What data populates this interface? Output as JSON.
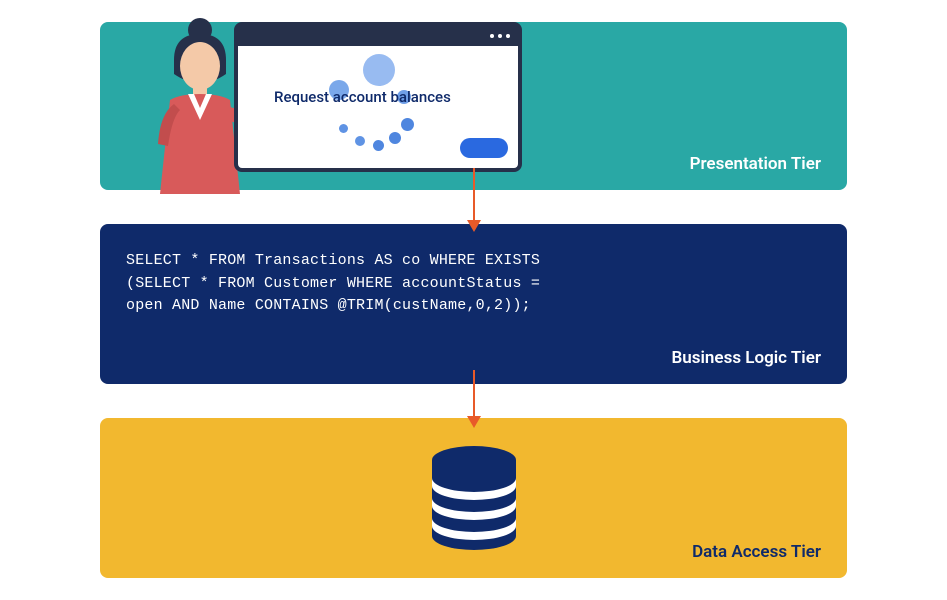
{
  "tiers": {
    "presentation": {
      "label": "Presentation Tier"
    },
    "logic": {
      "label": "Business Logic Tier"
    },
    "data": {
      "label": "Data Access Tier"
    }
  },
  "window": {
    "request_text": "Request account balances"
  },
  "sql": {
    "line1": "SELECT * FROM Transactions AS co WHERE EXISTS",
    "line2": "(SELECT * FROM Customer WHERE accountStatus =",
    "line3": "open AND Name CONTAINS @TRIM(custName,0,2));"
  },
  "colors": {
    "presentation_bg": "#29a8a5",
    "logic_bg": "#0f2a6a",
    "data_bg": "#f2b82f",
    "arrow": "#e85a29",
    "accent_blue": "#2a69e0"
  }
}
